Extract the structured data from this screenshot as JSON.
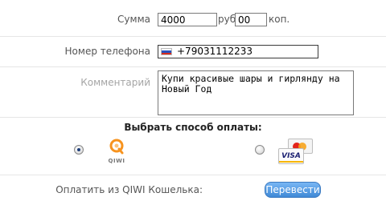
{
  "amount": {
    "label": "Сумма",
    "rub_value": "4000",
    "rub_unit": "руб.",
    "kop_value": "00",
    "kop_unit": "коп."
  },
  "phone": {
    "label": "Номер телефона",
    "flag": "russia-flag-icon",
    "value": "+79031112233"
  },
  "comment": {
    "label": "Комментарий",
    "value": "Купи красивые шары и гирлянду на Новый Год"
  },
  "payment": {
    "heading": "Выбрать способ оплаты:",
    "options": [
      {
        "id": "qiwi",
        "logo_text": "QIWI",
        "selected": true
      },
      {
        "id": "card",
        "logo_text": "VISA",
        "selected": false
      }
    ]
  },
  "footer": {
    "label": "Оплатить из QIWI Кошелька:",
    "button": "Перевести"
  },
  "colors": {
    "button": "#3f89d6",
    "qiwi_orange": "#f7931e",
    "visa_blue": "#1a1f71"
  }
}
